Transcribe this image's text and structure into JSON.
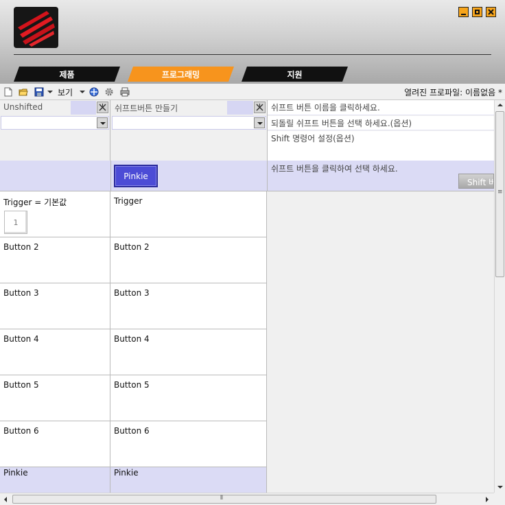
{
  "tabs": [
    {
      "label": "제품"
    },
    {
      "label": "프로그래밍"
    },
    {
      "label": "지원"
    }
  ],
  "toolbar": {
    "view_label": "보기",
    "open_profile_label": "열려진 프로파일: 이름없음 *"
  },
  "grid": {
    "col1_header": "Unshifted",
    "col2_header": "쉬프트버튼 만들기",
    "pinkie_button": "Pinkie",
    "default_button_value": "1",
    "rows": [
      {
        "c1": "Trigger  = 기본값",
        "c2": "Trigger"
      },
      {
        "c1": "Button 2",
        "c2": "Button 2"
      },
      {
        "c1": "Button 3",
        "c2": "Button 3"
      },
      {
        "c1": "Button 4",
        "c2": "Button 4"
      },
      {
        "c1": "Button 5",
        "c2": "Button 5"
      },
      {
        "c1": "Button 6",
        "c2": "Button 6"
      },
      {
        "c1": "Pinkie",
        "c2": "Pinkie"
      }
    ]
  },
  "help": {
    "line1": "쉬프트 버튼 이름을 클릭하세요.",
    "line2": "되돌릴 쉬프트 버튼을 선택 하세요.(옵션)",
    "line3": "Shift 명령어 설정(옵션)",
    "line4": "쉬프트 버튼을 클릭하여 선택 하세요.",
    "shift_button": "Shift 버"
  },
  "colors": {
    "accent": "#f7941d",
    "pinkie_row": "#dbdbf5",
    "pinkie_button": "#4c4cd6"
  }
}
